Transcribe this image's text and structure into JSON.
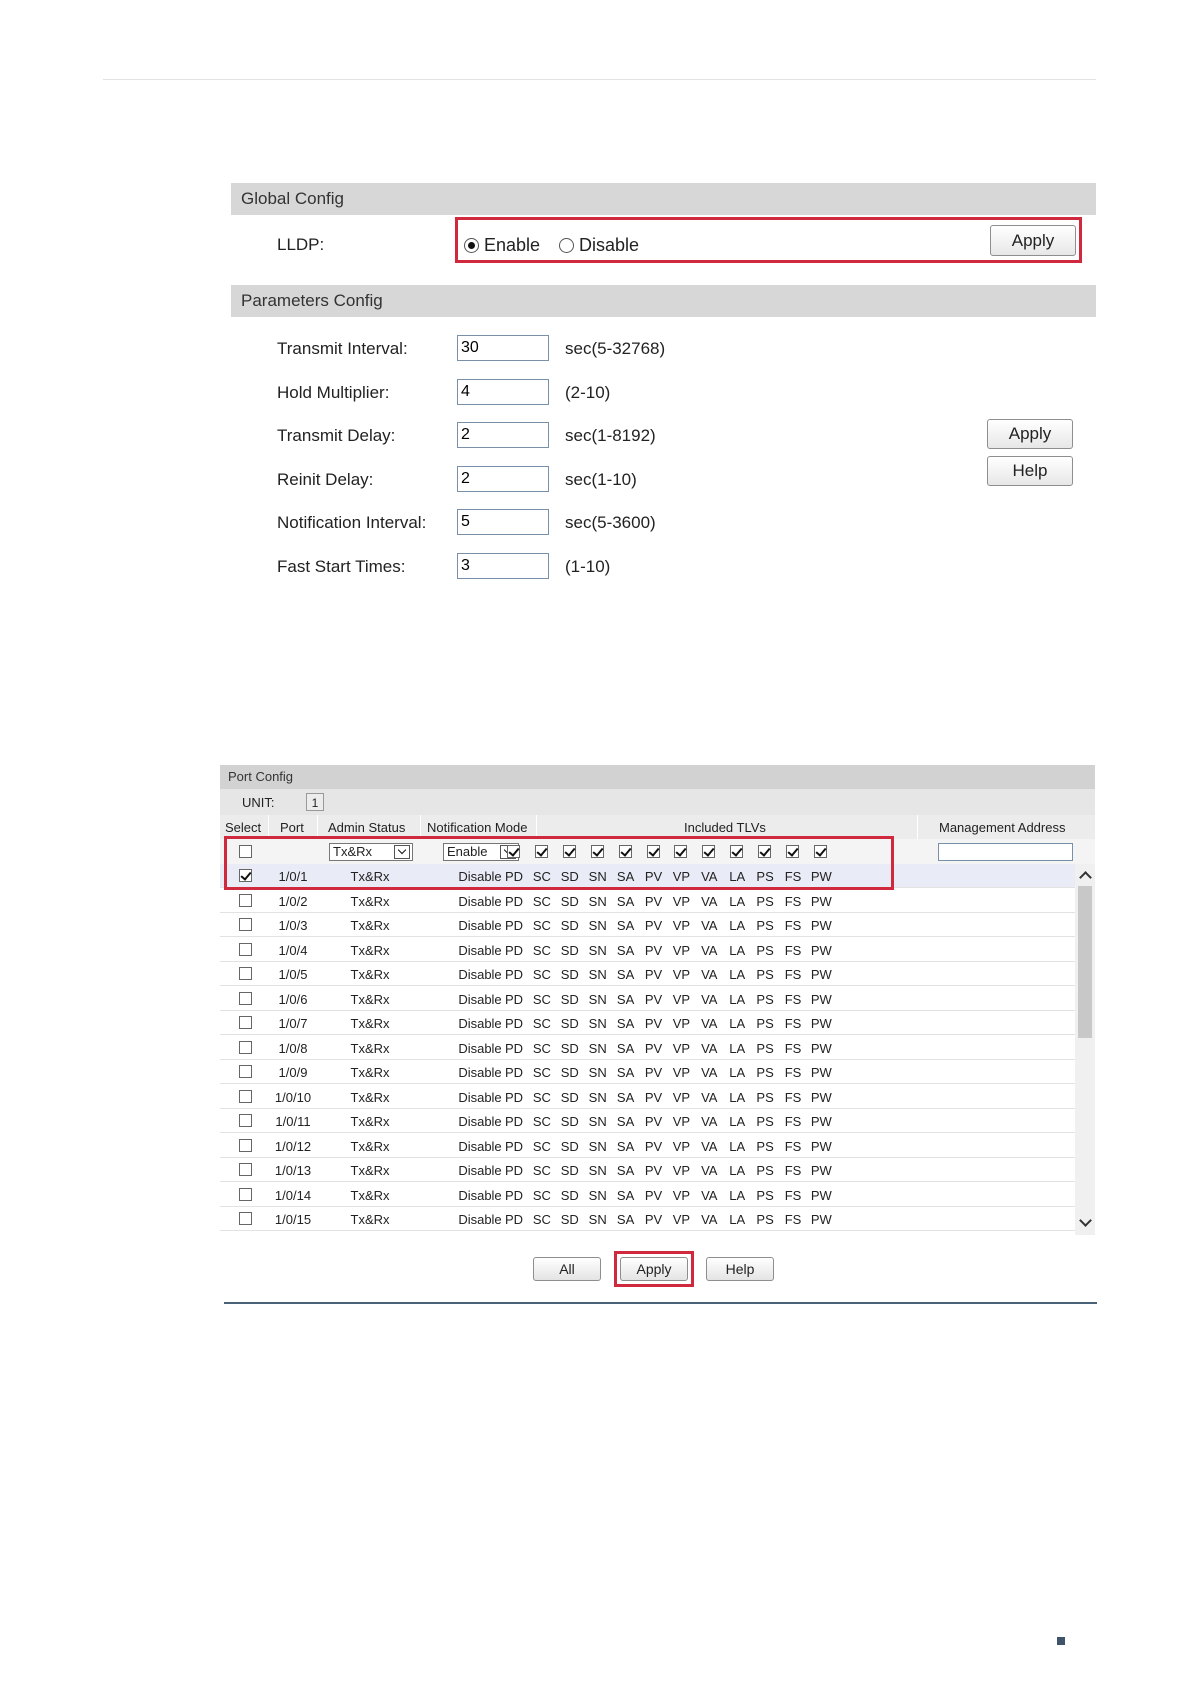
{
  "global_config": {
    "title": "Global Config",
    "lldp_label": "LLDP:",
    "enable_label": "Enable",
    "disable_label": "Disable",
    "selected": "Enable",
    "apply_label": "Apply"
  },
  "parameters_config": {
    "title": "Parameters Config",
    "params": [
      {
        "label": "Transmit Interval:",
        "value": "30",
        "range": "sec(5-32768)"
      },
      {
        "label": "Hold Multiplier:",
        "value": "4",
        "range": "(2-10)"
      },
      {
        "label": "Transmit Delay:",
        "value": "2",
        "range": "sec(1-8192)"
      },
      {
        "label": "Reinit Delay:",
        "value": "2",
        "range": "sec(1-10)"
      },
      {
        "label": "Notification Interval:",
        "value": "5",
        "range": "sec(5-3600)"
      },
      {
        "label": "Fast Start Times:",
        "value": "3",
        "range": "(1-10)"
      }
    ],
    "apply_label": "Apply",
    "help_label": "Help"
  },
  "port_config": {
    "title": "Port Config",
    "unit_label": "UNIT:",
    "unit_value": "1",
    "columns": [
      "Select",
      "Port",
      "Admin Status",
      "Notification Mode",
      "Included TLVs",
      "Management Address"
    ],
    "edit_row": {
      "admin_status": "Tx&Rx",
      "notification_mode": "Enable"
    },
    "tlv_names": [
      "PD",
      "SC",
      "SD",
      "SN",
      "SA",
      "PV",
      "VP",
      "VA",
      "LA",
      "PS",
      "FS",
      "PW"
    ],
    "rows": [
      {
        "port": "1/0/1",
        "admin": "Tx&Rx",
        "notify": "Disable",
        "selected": true
      },
      {
        "port": "1/0/2",
        "admin": "Tx&Rx",
        "notify": "Disable",
        "selected": false
      },
      {
        "port": "1/0/3",
        "admin": "Tx&Rx",
        "notify": "Disable",
        "selected": false
      },
      {
        "port": "1/0/4",
        "admin": "Tx&Rx",
        "notify": "Disable",
        "selected": false
      },
      {
        "port": "1/0/5",
        "admin": "Tx&Rx",
        "notify": "Disable",
        "selected": false
      },
      {
        "port": "1/0/6",
        "admin": "Tx&Rx",
        "notify": "Disable",
        "selected": false
      },
      {
        "port": "1/0/7",
        "admin": "Tx&Rx",
        "notify": "Disable",
        "selected": false
      },
      {
        "port": "1/0/8",
        "admin": "Tx&Rx",
        "notify": "Disable",
        "selected": false
      },
      {
        "port": "1/0/9",
        "admin": "Tx&Rx",
        "notify": "Disable",
        "selected": false
      },
      {
        "port": "1/0/10",
        "admin": "Tx&Rx",
        "notify": "Disable",
        "selected": false
      },
      {
        "port": "1/0/11",
        "admin": "Tx&Rx",
        "notify": "Disable",
        "selected": false
      },
      {
        "port": "1/0/12",
        "admin": "Tx&Rx",
        "notify": "Disable",
        "selected": false
      },
      {
        "port": "1/0/13",
        "admin": "Tx&Rx",
        "notify": "Disable",
        "selected": false
      },
      {
        "port": "1/0/14",
        "admin": "Tx&Rx",
        "notify": "Disable",
        "selected": false
      },
      {
        "port": "1/0/15",
        "admin": "Tx&Rx",
        "notify": "Disable",
        "selected": false
      }
    ],
    "all_label": "All",
    "apply_label": "Apply",
    "help_label": "Help"
  },
  "colors": {
    "highlight": "#d0283c",
    "header_bg": "#d7d7d7",
    "selected_row": "#e9ecf7"
  }
}
